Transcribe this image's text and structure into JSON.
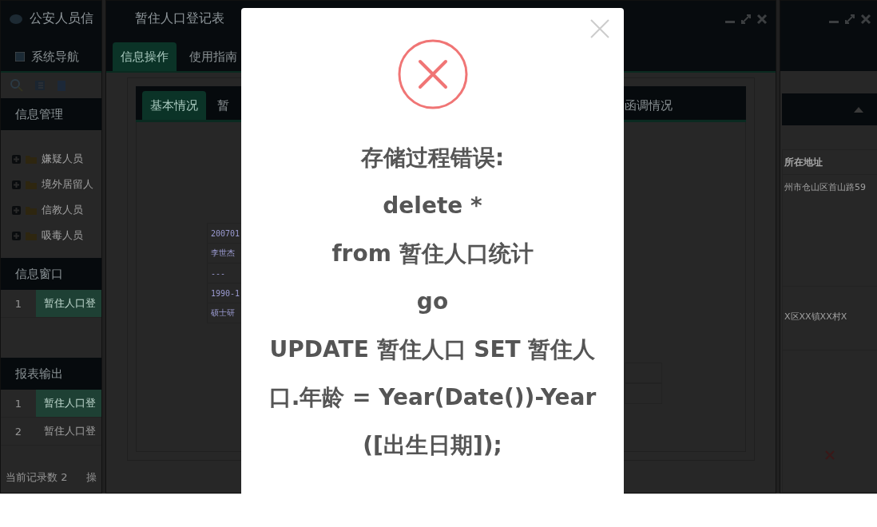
{
  "left_window": {
    "title": "公安人员信",
    "nav_tab": "系统导航",
    "tree_title": "信息管理",
    "tree_items": [
      {
        "label": "嫌疑人员",
        "expanded": false
      },
      {
        "label": "境外居留人",
        "expanded": false
      },
      {
        "label": "信教人员",
        "expanded": false
      },
      {
        "label": "吸毒人员",
        "expanded": false
      }
    ],
    "window_list": {
      "title": "信息窗口",
      "rows": [
        {
          "index": "1",
          "label": "暂住人口登",
          "selected": true
        }
      ]
    },
    "report_list": {
      "title": "报表输出",
      "rows": [
        {
          "index": "1",
          "label": "暂住人口登",
          "selected": true
        },
        {
          "index": "2",
          "label": "暂住人口登",
          "selected": false
        }
      ]
    },
    "status": "当前记录数 2",
    "status_2": "操"
  },
  "main_window": {
    "title": "暂住人口登记表",
    "tabs": [
      {
        "label": "信息操作",
        "selected": true
      },
      {
        "label": "使用指南",
        "selected": false
      }
    ],
    "form_tabs": [
      {
        "label": "基本情况",
        "selected": true
      },
      {
        "label": "暂",
        "selected": false
      },
      {
        "label": "函调情况",
        "selected": false
      }
    ],
    "record_cells": [
      "200701",
      "李世杰",
      "---",
      "1990-1",
      "硕士研"
    ]
  },
  "right_window": {
    "column_header": "所在地址",
    "cells": [
      "州市仓山区首山路59",
      "X区XX镇XX村X"
    ]
  },
  "dialog": {
    "lines": [
      "存储过程错误:",
      "delete *",
      "from 暂住人口统计",
      "go",
      "UPDATE 暂住人口 SET 暂住人口.年龄 = Year(Date())-Year([出生日期]);"
    ]
  }
}
